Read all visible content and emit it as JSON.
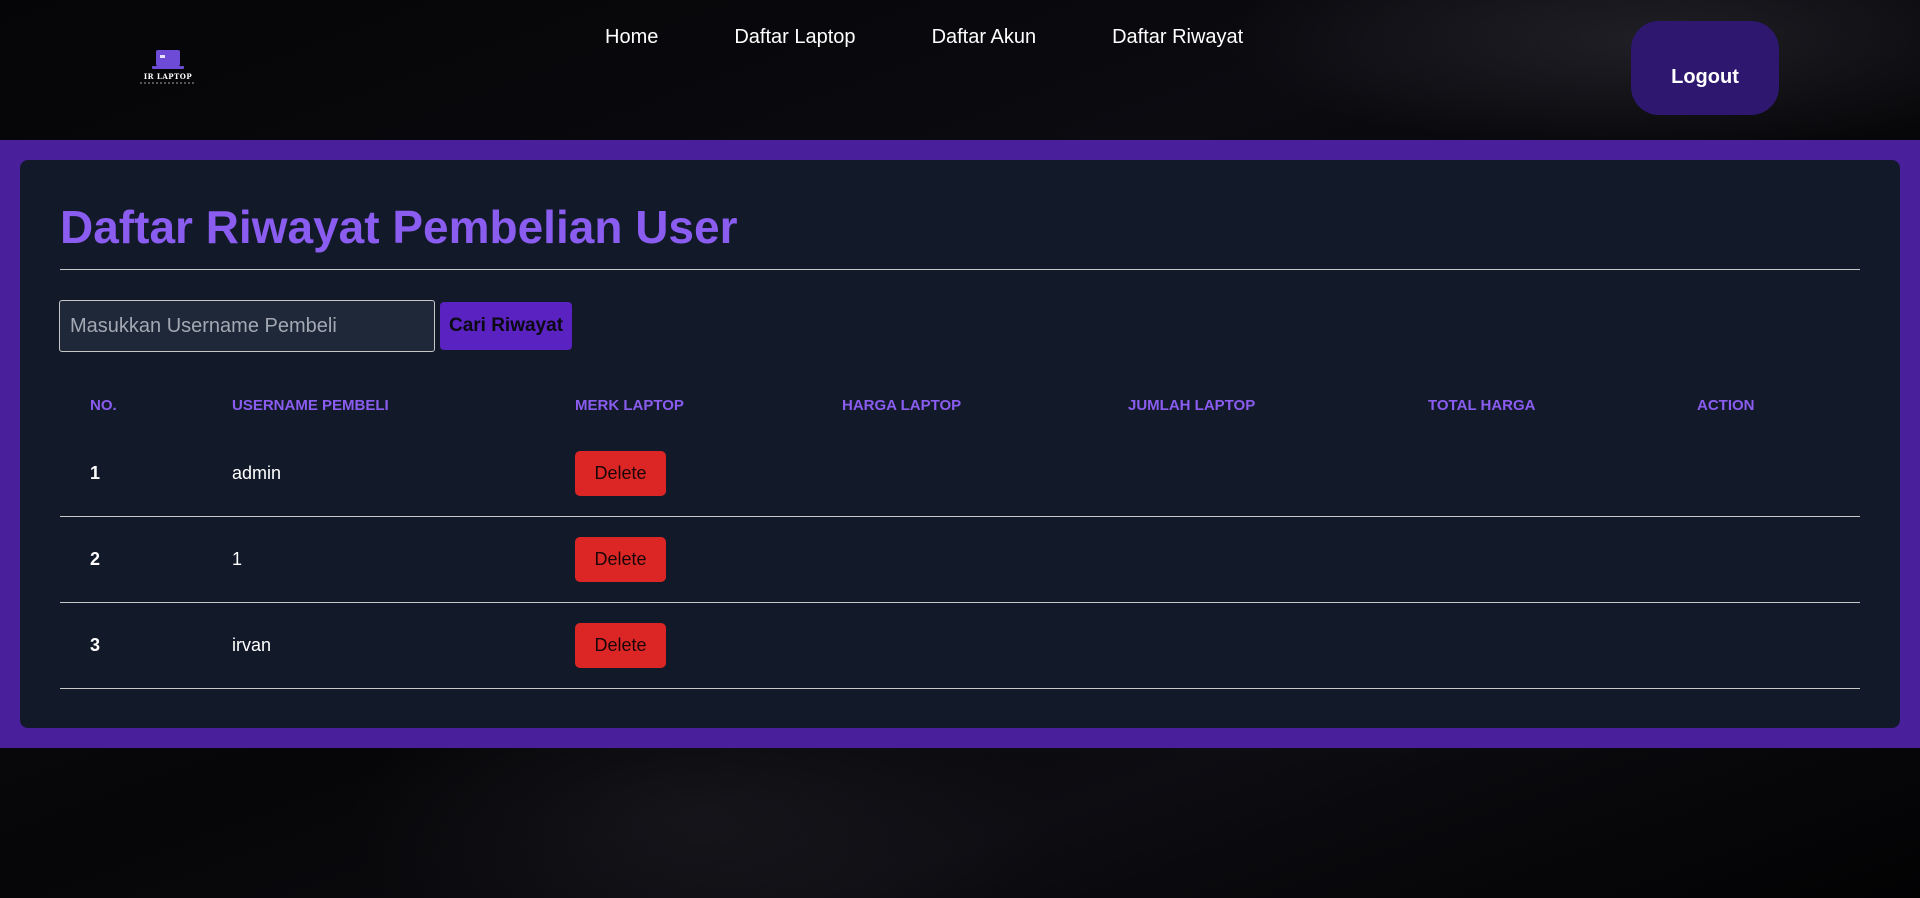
{
  "nav": {
    "logo_text": "IR LAPTOP",
    "items": [
      "Home",
      "Daftar Laptop",
      "Daftar Akun",
      "Daftar Riwayat"
    ],
    "logout_label": "Logout"
  },
  "main": {
    "title": "Daftar Riwayat Pembelian User",
    "search": {
      "placeholder": "Masukkan Username Pembeli",
      "value": "",
      "button_label": "Cari Riwayat"
    },
    "table": {
      "headers": [
        "NO.",
        "USERNAME PEMBELI",
        "MERK LAPTOP",
        "HARGA LAPTOP",
        "JUMLAH LAPTOP",
        "TOTAL HARGA",
        "ACTION"
      ],
      "rows": [
        {
          "no": "1",
          "username": "admin",
          "action": "Delete"
        },
        {
          "no": "2",
          "username": "1",
          "action": "Delete"
        },
        {
          "no": "3",
          "username": "irvan",
          "action": "Delete"
        }
      ]
    }
  },
  "colors": {
    "accent": "#8a5cf0",
    "band": "#4a1f9c",
    "panel": "#121a2a",
    "logout": "#2e176e",
    "search_button": "#5a22c0",
    "delete": "#dc2626"
  }
}
